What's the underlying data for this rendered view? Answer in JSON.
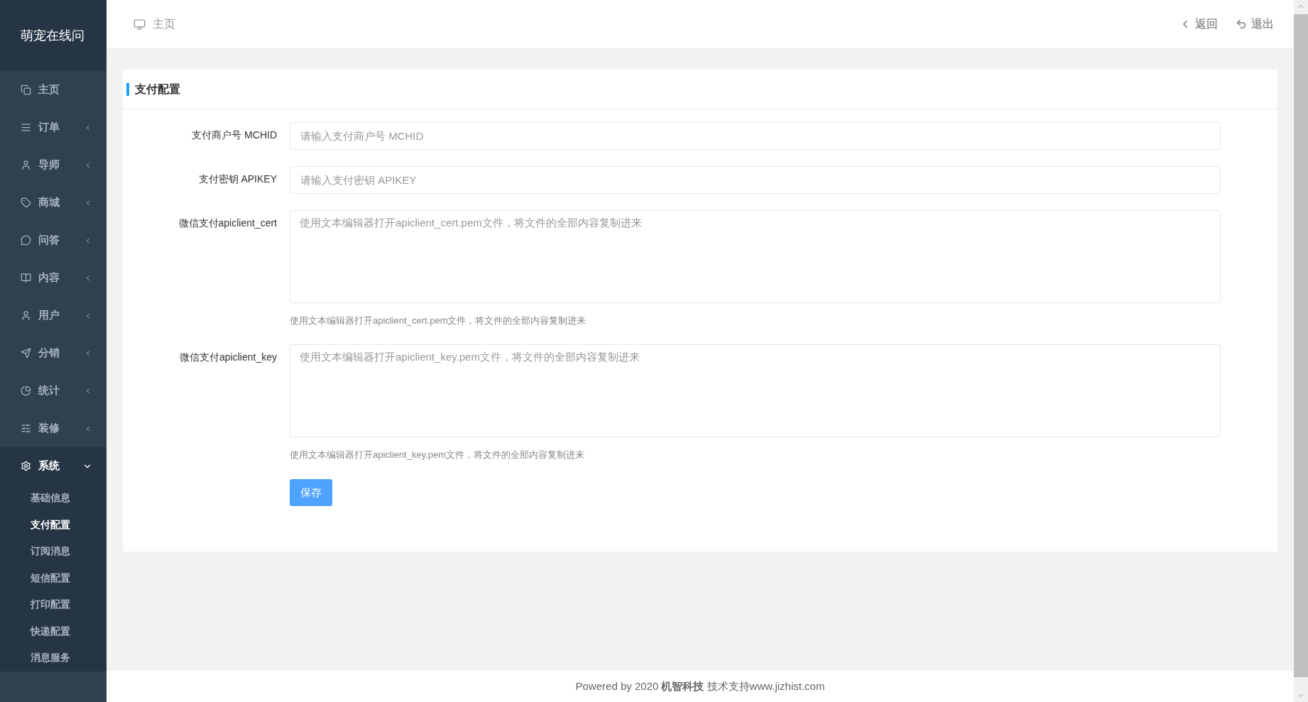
{
  "sidebar": {
    "logo": "萌宠在线问",
    "items": [
      {
        "label": "主页",
        "kind": "link",
        "expanded": false
      },
      {
        "label": "订单",
        "kind": "group",
        "expanded": false
      },
      {
        "label": "导师",
        "kind": "group",
        "expanded": false
      },
      {
        "label": "商城",
        "kind": "group",
        "expanded": false
      },
      {
        "label": "问答",
        "kind": "group",
        "expanded": false
      },
      {
        "label": "内容",
        "kind": "group",
        "expanded": false
      },
      {
        "label": "用户",
        "kind": "group",
        "expanded": false
      },
      {
        "label": "分销",
        "kind": "group",
        "expanded": false
      },
      {
        "label": "统计",
        "kind": "group",
        "expanded": false
      },
      {
        "label": "装修",
        "kind": "group",
        "expanded": false
      },
      {
        "label": "系统",
        "kind": "group",
        "expanded": true,
        "children": [
          {
            "label": "基础信息",
            "selected": false
          },
          {
            "label": "支付配置",
            "selected": true
          },
          {
            "label": "订阅消息",
            "selected": false
          },
          {
            "label": "短信配置",
            "selected": false
          },
          {
            "label": "打印配置",
            "selected": false
          },
          {
            "label": "快递配置",
            "selected": false
          },
          {
            "label": "消息服务",
            "selected": false
          }
        ]
      }
    ]
  },
  "header": {
    "breadcrumb": "主页",
    "back": "返回",
    "logout": "退出"
  },
  "card": {
    "title": "支付配置",
    "fields": [
      {
        "label": "支付商户号 MCHID",
        "kind": "input",
        "placeholder": "请输入支付商户号 MCHID"
      },
      {
        "label": "支付密钥 APIKEY",
        "kind": "input",
        "placeholder": "请输入支付密钥 APIKEY"
      },
      {
        "label": "微信支付apiclient_cert",
        "kind": "textarea",
        "placeholder": "使用文本编辑器打开apiclient_cert.pem文件，将文件的全部内容复制进来",
        "help": "使用文本编辑器打开apiclient_cert.pem文件，将文件的全部内容复制进来"
      },
      {
        "label": "微信支付apiclient_key",
        "kind": "textarea",
        "placeholder": "使用文本编辑器打开apiclient_key.pem文件，将文件的全部内容复制进来",
        "help": "使用文本编辑器打开apiclient_key.pem文件，将文件的全部内容复制进来"
      }
    ],
    "save": "保存"
  },
  "footer": "Powered by 2020 **机智科技** 技术支持www.jizhist.com"
}
